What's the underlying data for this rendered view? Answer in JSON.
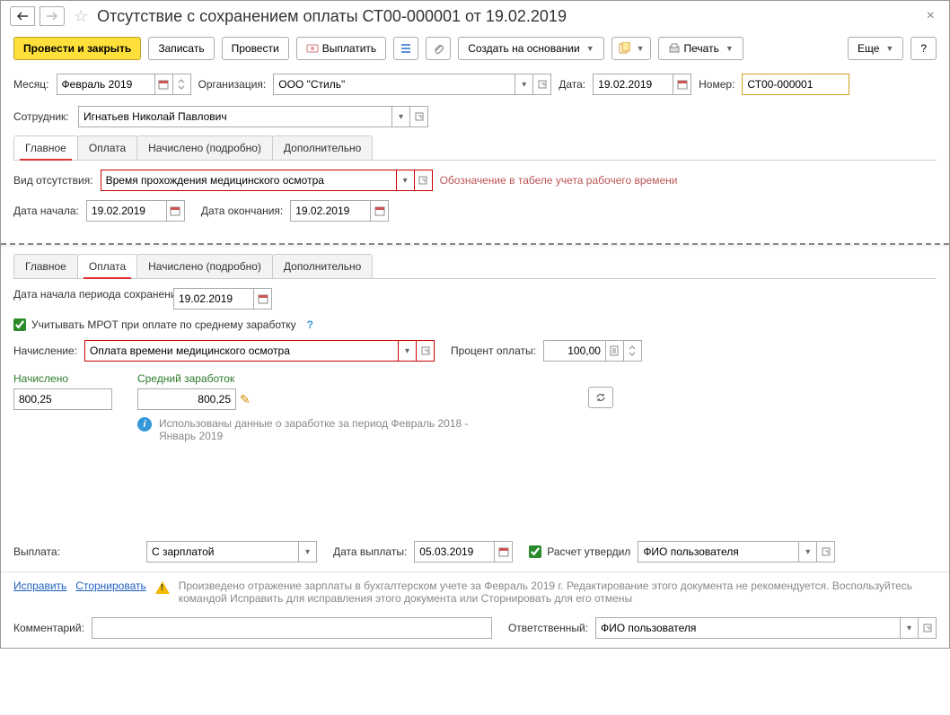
{
  "title": "Отсутствие с сохранением оплаты СТ00-000001 от 19.02.2019",
  "toolbar": {
    "post_close": "Провести и закрыть",
    "save": "Записать",
    "post": "Провести",
    "pay": "Выплатить",
    "create_basis": "Создать на основании",
    "print": "Печать",
    "more": "Еще",
    "help": "?"
  },
  "header": {
    "month_label": "Месяц:",
    "month_value": "Февраль 2019",
    "org_label": "Организация:",
    "org_value": "ООО \"Стиль\"",
    "date_label": "Дата:",
    "date_value": "19.02.2019",
    "number_label": "Номер:",
    "number_value": "СТ00-000001",
    "employee_label": "Сотрудник:",
    "employee_value": "Игнатьев Николай Павлович"
  },
  "tabs": [
    "Главное",
    "Оплата",
    "Начислено (подробно)",
    "Дополнительно"
  ],
  "main_tab": {
    "absence_type_label": "Вид отсутствия:",
    "absence_type_value": "Время прохождения медицинского осмотра",
    "timesheet_note": "Обозначение в табеле учета рабочего времени",
    "start_label": "Дата начала:",
    "start_value": "19.02.2019",
    "end_label": "Дата окончания:",
    "end_value": "19.02.2019"
  },
  "payment_tab": {
    "period_start_label": "Дата начала периода сохранения заработка:",
    "period_start_value": "19.02.2019",
    "mrot_checkbox": "Учитывать МРОТ при оплате по среднему заработку",
    "accrual_label": "Начисление:",
    "accrual_value": "Оплата времени медицинского осмотра",
    "percent_label": "Процент оплаты:",
    "percent_value": "100,00",
    "accrued_label": "Начислено",
    "accrued_value": "800,25",
    "avg_earn_label": "Средний заработок",
    "avg_earn_value": "800,25",
    "info_text": "Использованы данные о заработке за период Февраль 2018 - Январь 2019",
    "payout_label": "Выплата:",
    "payout_value": "С зарплатой",
    "payout_date_label": "Дата выплаты:",
    "payout_date_value": "05.03.2019",
    "approved_label": "Расчет утвердил",
    "approved_value": "ФИО пользователя"
  },
  "footer": {
    "correct_link": "Исправить",
    "storno_link": "Сторнировать",
    "warning_text": "Произведено отражение зарплаты в бухгалтерском учете за Февраль 2019 г. Редактирование этого документа не рекомендуется. Воспользуйтесь командой Исправить для исправления этого документа или Сторнировать для его отмены",
    "comment_label": "Комментарий:",
    "responsible_label": "Ответственный:",
    "responsible_value": "ФИО пользователя"
  }
}
